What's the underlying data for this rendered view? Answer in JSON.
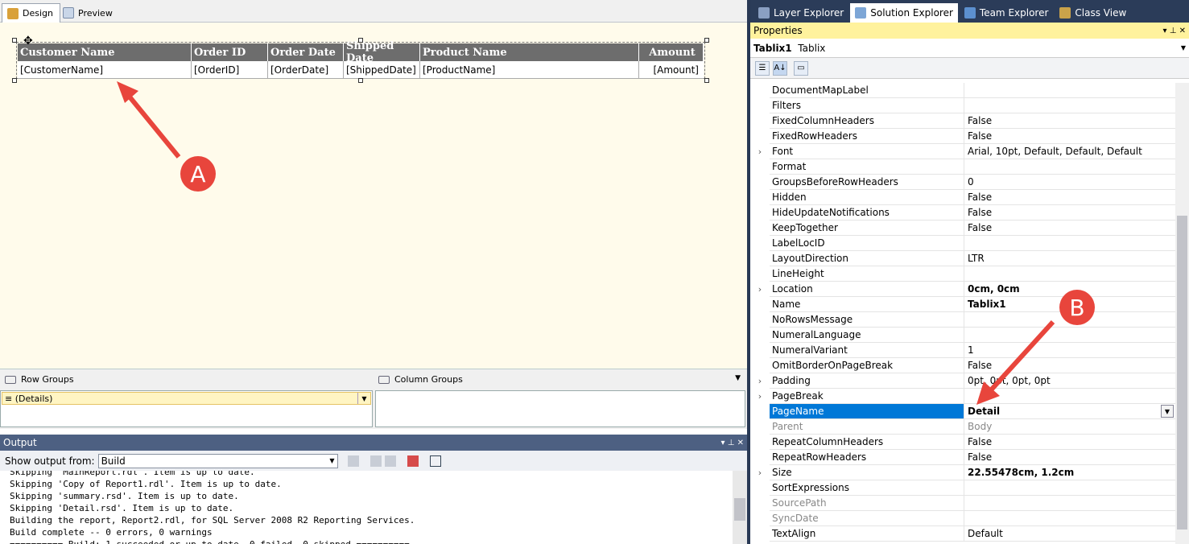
{
  "doc_tabs": [
    "Design",
    "Preview"
  ],
  "tablix": {
    "headers": [
      "Customer Name",
      "Order ID",
      "Order Date",
      "Shipped Date",
      "Product Name",
      "Amount"
    ],
    "cells": [
      "[CustomerName]",
      "[OrderID]",
      "[OrderDate]",
      "[ShippedDate]",
      "[ProductName]",
      "[Amount]"
    ]
  },
  "groups": {
    "row_title": "Row Groups",
    "col_title": "Column Groups",
    "row_item": "≡ (Details)"
  },
  "output": {
    "title": "Output",
    "show_from_label": "Show output from:",
    "show_from_value": "Build",
    "lines": [
      "Skipping 'MainReport.rdl'. Item is up to date.",
      "Skipping 'Copy of Report1.rdl'. Item is up to date.",
      "Skipping 'summary.rsd'. Item is up to date.",
      "Skipping 'Detail.rsd'. Item is up to date.",
      "Building the report, Report2.rdl, for SQL Server 2008 R2 Reporting Services.",
      "Build complete -- 0 errors, 0 warnings",
      "========== Build: 1 succeeded or up-to-date, 0 failed, 0 skipped =========="
    ]
  },
  "solution_tabs": [
    "Layer Explorer",
    "Solution Explorer",
    "Team Explorer",
    "Class View"
  ],
  "properties": {
    "title": "Properties",
    "object_name": "Tablix1",
    "object_type": "Tablix",
    "rows": [
      {
        "name": "DocumentMapLabel",
        "value": ""
      },
      {
        "name": "Filters",
        "value": ""
      },
      {
        "name": "FixedColumnHeaders",
        "value": "False"
      },
      {
        "name": "FixedRowHeaders",
        "value": "False"
      },
      {
        "name": "Font",
        "value": "Arial, 10pt, Default, Default, Default",
        "exp": true
      },
      {
        "name": "Format",
        "value": ""
      },
      {
        "name": "GroupsBeforeRowHeaders",
        "value": "0"
      },
      {
        "name": "Hidden",
        "value": "False"
      },
      {
        "name": "HideUpdateNotifications",
        "value": "False"
      },
      {
        "name": "KeepTogether",
        "value": "False"
      },
      {
        "name": "LabelLocID",
        "value": ""
      },
      {
        "name": "LayoutDirection",
        "value": "LTR"
      },
      {
        "name": "LineHeight",
        "value": ""
      },
      {
        "name": "Location",
        "value": "0cm, 0cm",
        "exp": true,
        "bold": true
      },
      {
        "name": "Name",
        "value": "Tablix1",
        "bold": true
      },
      {
        "name": "NoRowsMessage",
        "value": ""
      },
      {
        "name": "NumeralLanguage",
        "value": ""
      },
      {
        "name": "NumeralVariant",
        "value": "1"
      },
      {
        "name": "OmitBorderOnPageBreak",
        "value": "False"
      },
      {
        "name": "Padding",
        "value": "0pt, 0pt, 0pt, 0pt",
        "exp": true
      },
      {
        "name": "PageBreak",
        "value": "",
        "exp": true
      },
      {
        "name": "PageName",
        "value": "Detail",
        "bold": true,
        "sel": true
      },
      {
        "name": "Parent",
        "value": "Body",
        "ro": true
      },
      {
        "name": "RepeatColumnHeaders",
        "value": "False"
      },
      {
        "name": "RepeatRowHeaders",
        "value": "False"
      },
      {
        "name": "Size",
        "value": "22.55478cm, 1.2cm",
        "exp": true,
        "bold": true
      },
      {
        "name": "SortExpressions",
        "value": ""
      },
      {
        "name": "SourcePath",
        "value": "",
        "ro": true
      },
      {
        "name": "SyncDate",
        "value": "",
        "ro": true
      },
      {
        "name": "TextAlign",
        "value": "Default"
      }
    ]
  },
  "annotations": {
    "a": "A",
    "b": "B"
  },
  "colors": {
    "arrow": "#e8453c",
    "selection": "#0078d7",
    "header_bg": "#6d6d6d"
  }
}
